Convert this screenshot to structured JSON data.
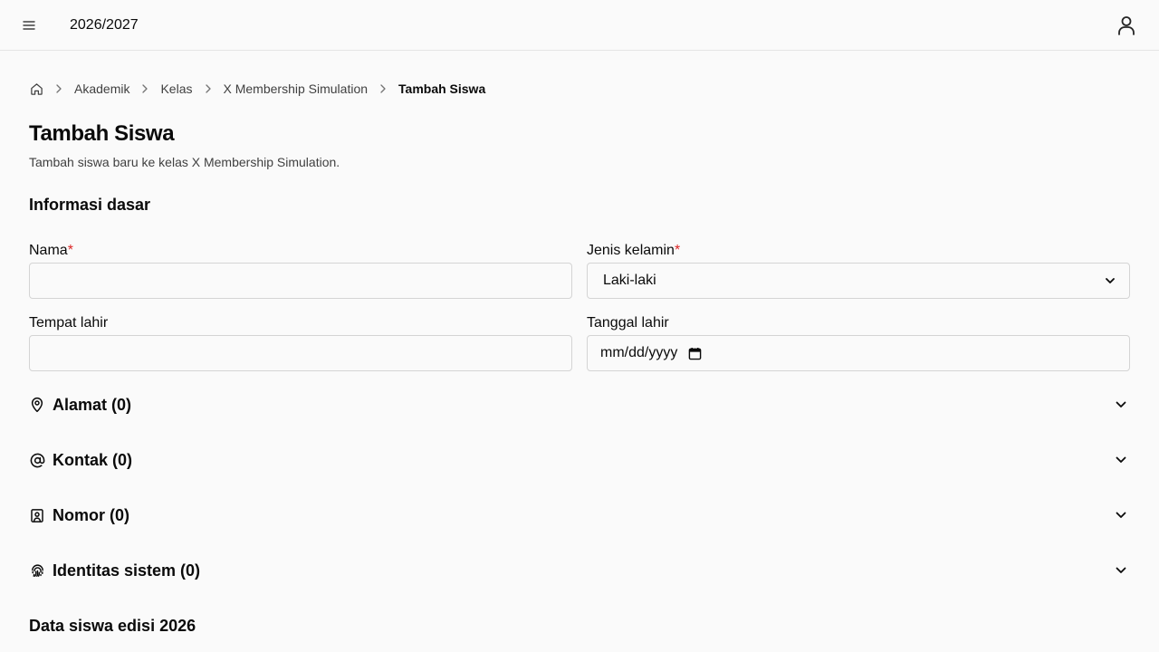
{
  "header": {
    "year": "2026/2027",
    "menu_icon": "hamburger-icon",
    "user_icon": "user-icon"
  },
  "breadcrumb": {
    "items": [
      "Akademik",
      "Kelas",
      "X Membership Simulation"
    ],
    "current": "Tambah Siswa"
  },
  "page": {
    "title": "Tambah Siswa",
    "subtitle": "Tambah siswa baru ke kelas X Membership Simulation."
  },
  "basic_info": {
    "title": "Informasi dasar",
    "name_label": "Nama",
    "required_mark": "*",
    "name_value": "",
    "gender_label": "Jenis kelamin",
    "gender_value": "Laki-laki",
    "birthplace_label": "Tempat lahir",
    "birthplace_value": "",
    "birthdate_label": "Tanggal lahir",
    "birthdate_placeholder": "mm/dd/yyyy"
  },
  "sections": {
    "address": "Alamat (0)",
    "contact": "Kontak (0)",
    "number": "Nomor (0)",
    "identity": "Identitas sistem (0)"
  },
  "student_data": {
    "title": "Data siswa edisi 2026"
  }
}
